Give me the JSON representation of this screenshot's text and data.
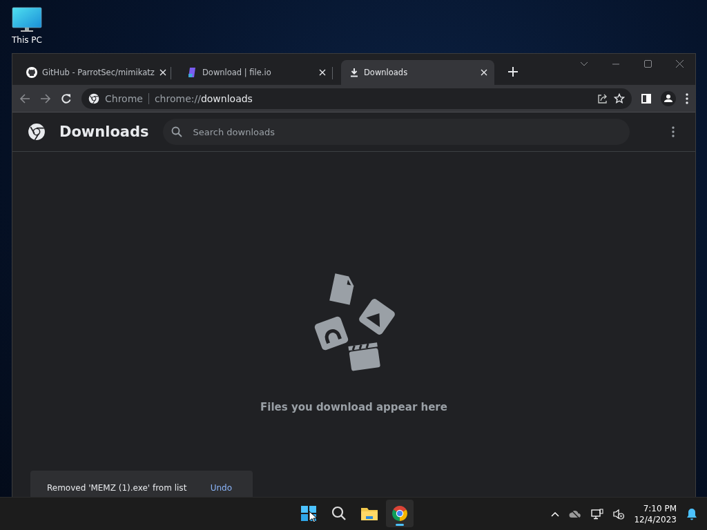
{
  "desktop_icons": [
    {
      "label": "This PC"
    }
  ],
  "browser": {
    "tabs": [
      {
        "title": "GitHub - ParrotSec/mimikatz",
        "kind": "github",
        "selected": false
      },
      {
        "title": "Download | file.io",
        "kind": "fileio",
        "selected": false
      },
      {
        "title": "Downloads",
        "kind": "download",
        "selected": true
      }
    ],
    "omnibox": {
      "chip": "Chrome",
      "url_scheme": "chrome://",
      "url_path": "downloads"
    },
    "page": {
      "title": "Downloads",
      "search": {
        "placeholder": "Search downloads"
      },
      "empty_message": "Files you download appear here",
      "toast": {
        "message": "Removed 'MEMZ (1).exe' from list",
        "action": "Undo"
      }
    }
  },
  "taskbar": {
    "apps": [
      {
        "kind": "start",
        "running": false
      },
      {
        "kind": "search",
        "running": false
      },
      {
        "kind": "explorer",
        "running": false
      },
      {
        "kind": "chrome",
        "running": true
      }
    ],
    "clock": {
      "time": "7:10 PM",
      "date": "12/4/2023"
    }
  }
}
